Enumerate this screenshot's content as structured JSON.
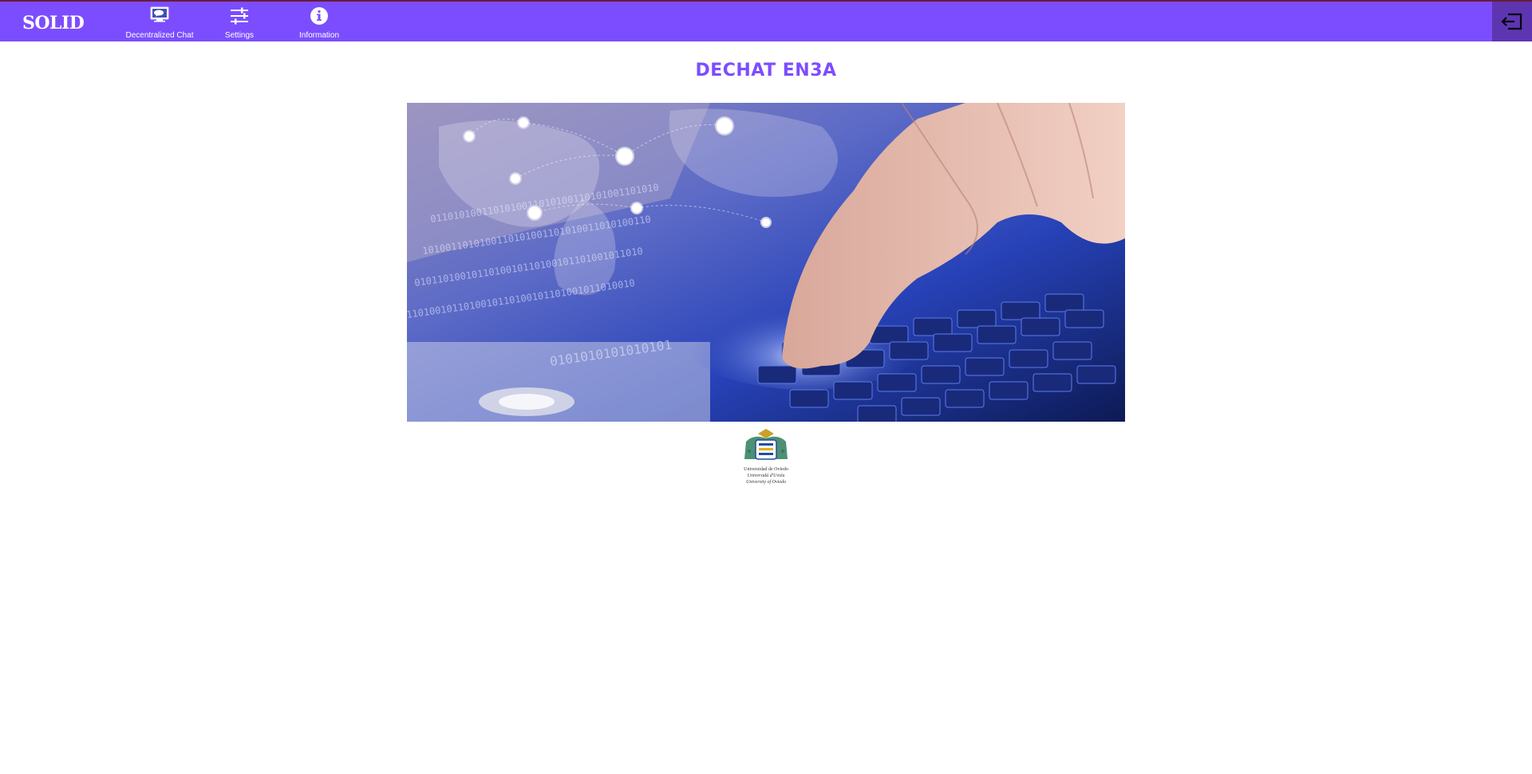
{
  "header": {
    "brand": "SOLID",
    "nav": [
      {
        "label": "Decentralized Chat",
        "icon": "chat-screen-icon"
      },
      {
        "label": "Settings",
        "icon": "sliders-icon"
      },
      {
        "label": "Information",
        "icon": "info-icon"
      }
    ],
    "logout_icon": "logout-icon"
  },
  "main": {
    "title": "DECHAT EN3A",
    "hero_image": "keyboard-world-map-image"
  },
  "footer_logo": {
    "icon": "university-crest-logo",
    "lines": [
      "Universidad de Oviedo",
      "Universidá d'Uviéu",
      "University of Oviedo"
    ]
  },
  "colors": {
    "accent": "#7c4dff",
    "logout_bg": "#5e35b1",
    "background": "#ffffff"
  }
}
